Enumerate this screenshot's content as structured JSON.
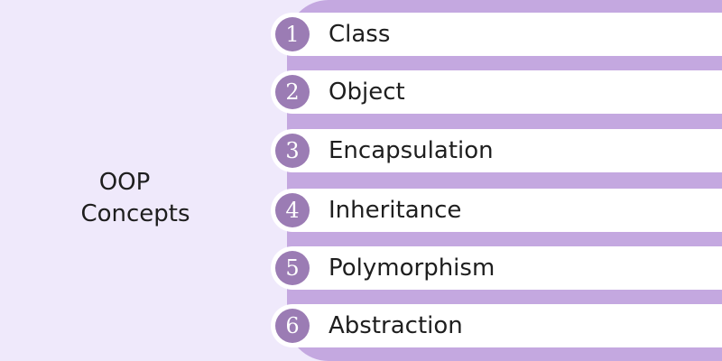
{
  "title": {
    "line1": "OOP",
    "line2": "Concepts"
  },
  "concepts": [
    {
      "number": "1",
      "label": "Class"
    },
    {
      "number": "2",
      "label": "Object"
    },
    {
      "number": "3",
      "label": "Encapsulation"
    },
    {
      "number": "4",
      "label": "Inheritance"
    },
    {
      "number": "5",
      "label": "Polymorphism"
    },
    {
      "number": "6",
      "label": "Abstraction"
    }
  ],
  "colors": {
    "background": "#efe9fb",
    "panel": "#c4a8e0",
    "row": "#ffffff",
    "badge": "#9b7cb4",
    "text": "#1e1e1e"
  }
}
